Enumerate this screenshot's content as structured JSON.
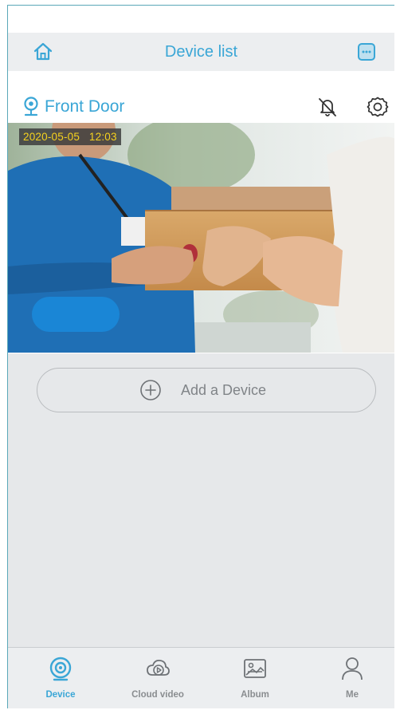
{
  "header": {
    "title": "Device list",
    "home_icon": "home-icon",
    "message_icon": "message-icon"
  },
  "device": {
    "name": "Front Door",
    "timestamp": "2020-05-05   12:03",
    "icons": [
      "location-pin-icon",
      "bell-off-icon",
      "gear-icon"
    ]
  },
  "add_device": {
    "label": "Add a Device"
  },
  "tabs": [
    {
      "label": "Device",
      "icon": "camera-icon",
      "active": true
    },
    {
      "label": "Cloud video",
      "icon": "cloud-play-icon",
      "active": false
    },
    {
      "label": "Album",
      "icon": "image-icon",
      "active": false
    },
    {
      "label": "Me",
      "icon": "person-icon",
      "active": false
    }
  ],
  "colors": {
    "accent": "#3aa6d6",
    "timestamp": "#f5d21e",
    "pill": "#1a86d6"
  }
}
